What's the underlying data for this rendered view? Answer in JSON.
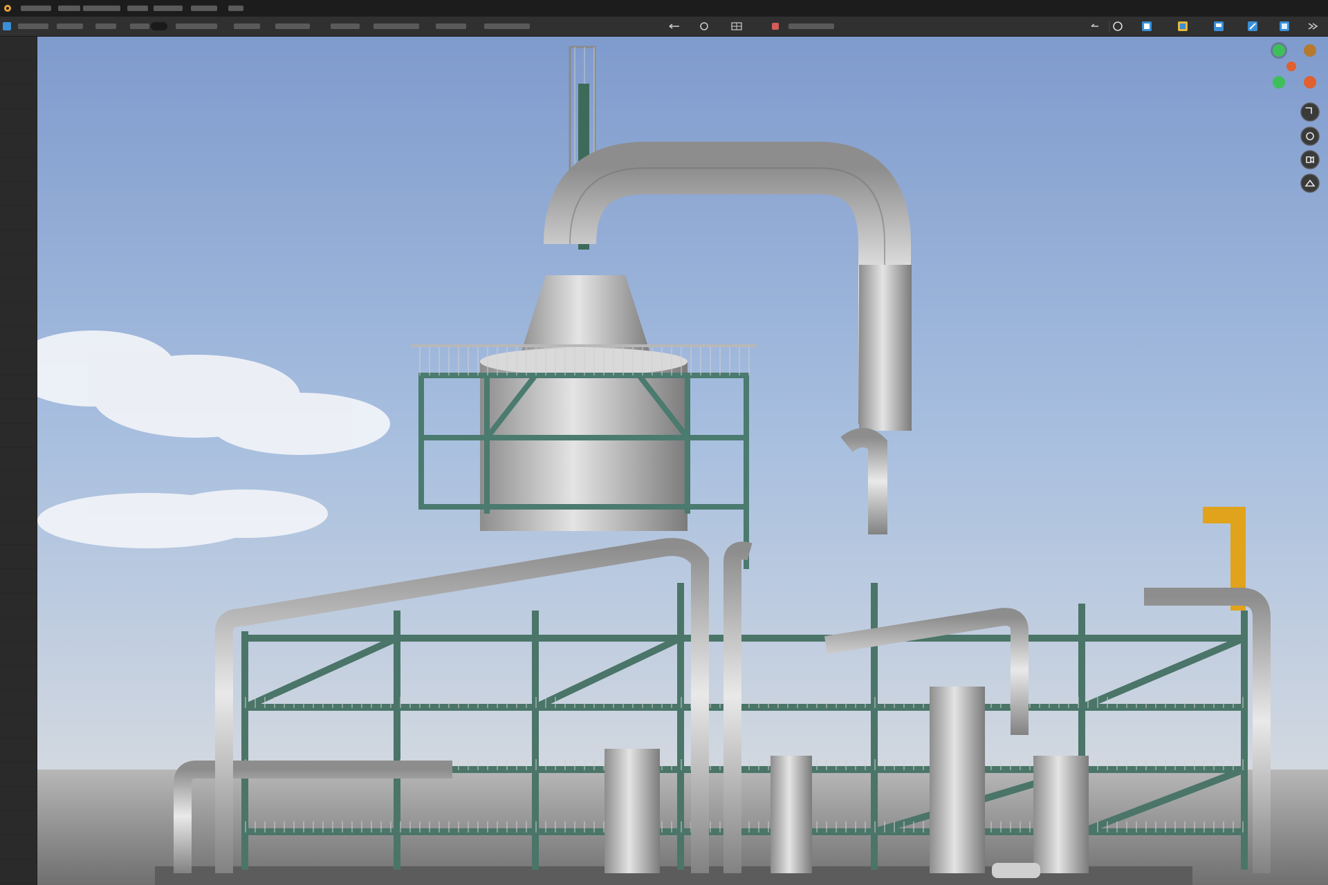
{
  "app": {
    "accent_color": "#3a8fd6"
  },
  "menubar": {
    "app_icon": "app-logo-icon"
  },
  "toolbar": {
    "icons": [
      "undo-icon",
      "orbit-icon",
      "grid-icon",
      "material-icon",
      "refresh-icon",
      "viewport-shading-solid-icon",
      "viewport-shading-material-icon",
      "viewport-shading-rendered-icon",
      "overlay-icon",
      "xray-icon",
      "collapse-icon"
    ]
  },
  "viewport": {
    "content": "3d-industrial-plant-render",
    "gizmo": {
      "axis_colors": {
        "x": "#e0602f",
        "y": "#3fbf5a",
        "z": "#3a8fd6"
      }
    },
    "nav_buttons": [
      "zoom-icon",
      "pan-icon",
      "camera-icon",
      "perspective-icon"
    ]
  }
}
